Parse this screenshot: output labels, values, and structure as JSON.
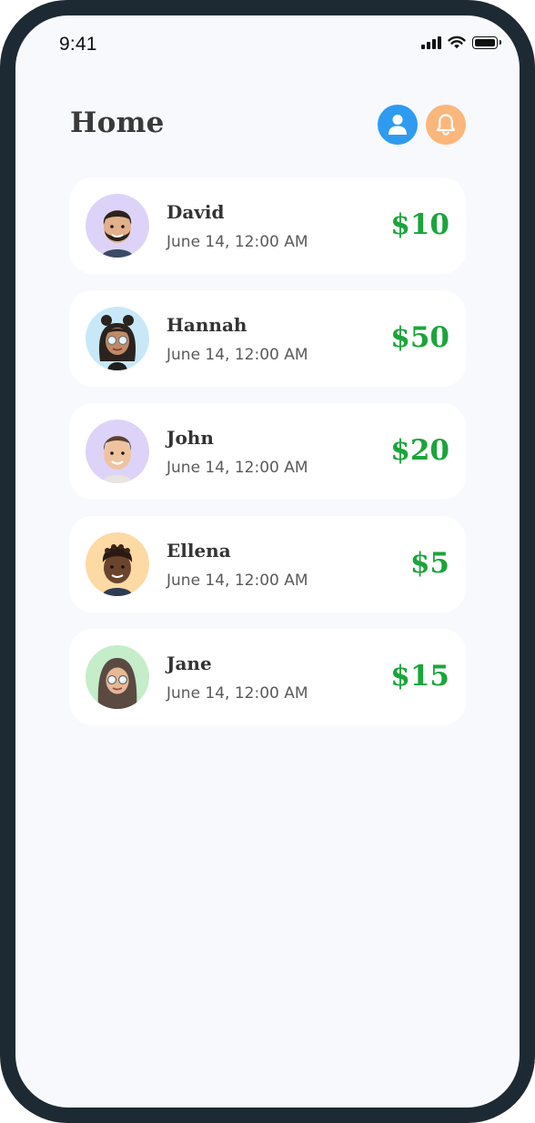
{
  "status_bar": {
    "time": "9:41",
    "icons": [
      "cellular-signal-icon",
      "wifi-icon",
      "battery-icon"
    ]
  },
  "header": {
    "title": "Home",
    "profile_icon": "user-icon",
    "notification_icon": "bell-icon"
  },
  "colors": {
    "amount": "#1aa53a",
    "profile_button": "#2e9bf0",
    "bell_button": "#fbb67c",
    "background": "#f7f9fd"
  },
  "transactions": [
    {
      "name": "David",
      "date": "June 14, 12:00 AM",
      "amount": "$10",
      "avatar_bg": "#ddd3f8"
    },
    {
      "name": "Hannah",
      "date": "June 14, 12:00 AM",
      "amount": "$50",
      "avatar_bg": "#c8e8f8"
    },
    {
      "name": "John",
      "date": "June 14, 12:00 AM",
      "amount": "$20",
      "avatar_bg": "#ddd3f8"
    },
    {
      "name": "Ellena",
      "date": "June 14, 12:00 AM",
      "amount": "$5",
      "avatar_bg": "#fdd9a4"
    },
    {
      "name": "Jane",
      "date": "June 14, 12:00 AM",
      "amount": "$15",
      "avatar_bg": "#c5edc9"
    }
  ]
}
